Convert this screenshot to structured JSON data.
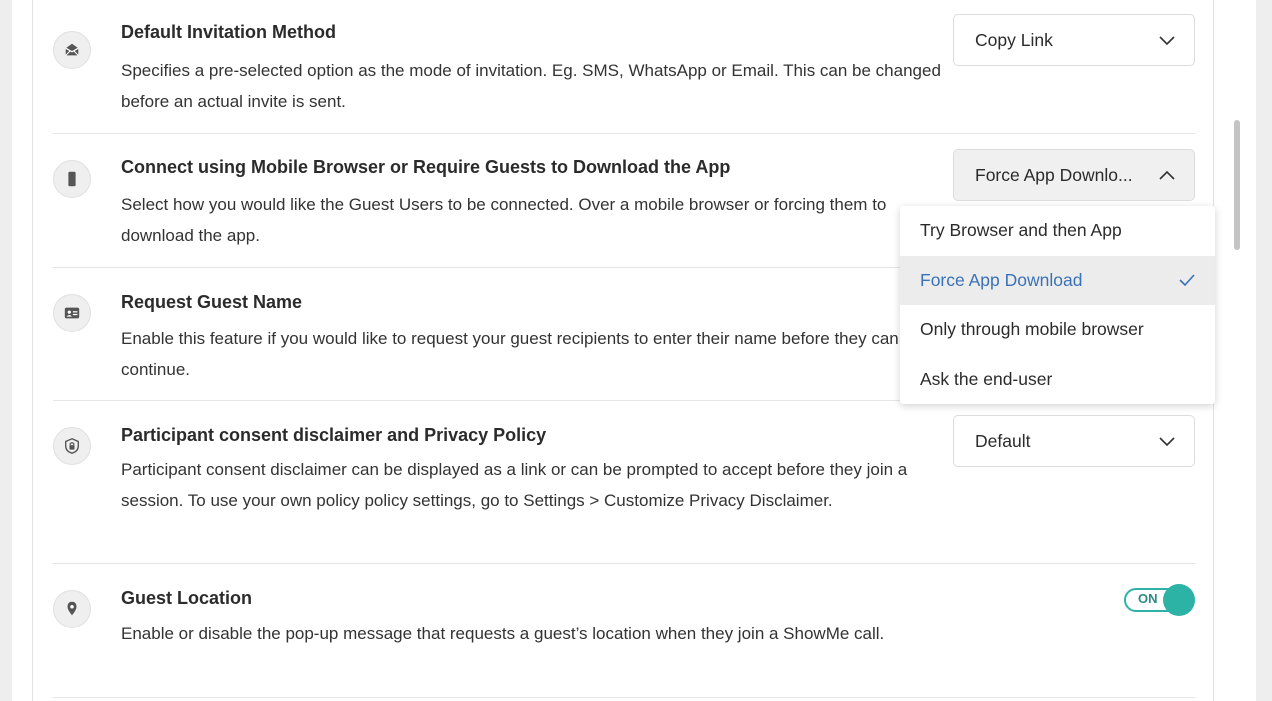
{
  "rows": [
    {
      "title": "Default Invitation Method",
      "desc": "Specifies a pre-selected option as the mode of invitation. Eg. SMS, WhatsApp or Email. This can be changed before an actual invite is sent.",
      "control_value": "Copy Link",
      "icon": "envelope-icon"
    },
    {
      "title": "Connect using Mobile Browser or Require Guests to Download the App",
      "desc": "Select how you would like the Guest Users to be connected. Over a mobile browser or forcing them to download the app.",
      "control_value": "Force App Downlo...",
      "icon": "mobile-phone-icon"
    },
    {
      "title": "Request Guest Name",
      "desc": "Enable this feature if you would like to request your guest recipients to enter their name before they can continue.",
      "icon": "id-card-icon"
    },
    {
      "title": "Participant consent disclaimer and Privacy Policy",
      "desc": "Participant consent disclaimer can be displayed as a link or can be prompted to accept before they join a session. To use your own policy policy settings, go to Settings > Customize Privacy Disclaimer.",
      "control_value": "Default",
      "icon": "shield-lock-icon"
    },
    {
      "title": "Guest Location",
      "desc": "Enable or disable the pop-up message that requests a guest’s location when they join a ShowMe call.",
      "toggle_label": "ON",
      "toggle_on": true,
      "icon": "location-pin-icon"
    }
  ],
  "dropdown_menu": {
    "options": [
      "Try Browser and then App",
      "Force App Download",
      "Only through mobile browser",
      "Ask the end-user"
    ],
    "selected": "Force App Download"
  },
  "colors": {
    "accent": "#2db3a6",
    "selected_text": "#3a72b8"
  }
}
